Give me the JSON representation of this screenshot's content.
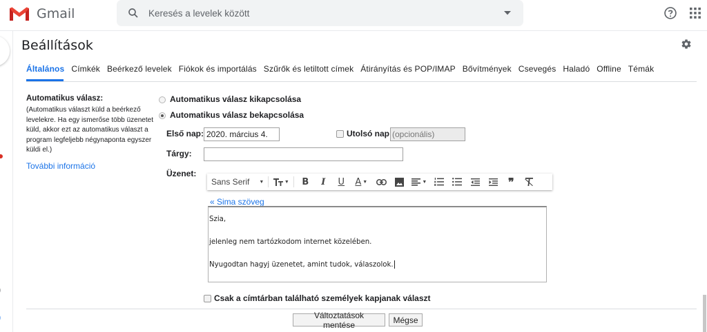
{
  "app": {
    "name": "Gmail"
  },
  "search": {
    "placeholder": "Keresés a levelek között"
  },
  "page": {
    "title": "Beállítások"
  },
  "tabs": [
    {
      "label": "Általános",
      "active": true
    },
    {
      "label": "Címkék"
    },
    {
      "label": "Beérkező levelek"
    },
    {
      "label": "Fiókok és importálás"
    },
    {
      "label": "Szűrők és letiltott címek"
    },
    {
      "label": "Átirányítás és POP/IMAP"
    },
    {
      "label": "Bővítmények"
    },
    {
      "label": "Csevegés"
    },
    {
      "label": "Haladó"
    },
    {
      "label": "Offline"
    },
    {
      "label": "Témák"
    }
  ],
  "setting": {
    "label": "Automatikus válasz:",
    "description": "(Automatikus választ küld a beérkező levelekre. Ha egy ismerőse több üzenetet küld, akkor ezt az automatikus választ a program legfeljebb négynaponta egyszer küldi el.)",
    "more_link": "További információ"
  },
  "options": {
    "off_label": "Automatikus válasz kikapcsolása",
    "on_label": "Automatikus válasz bekapcsolása",
    "selected": "on"
  },
  "form": {
    "first_day_label": "Első nap:",
    "first_day_value": "2020. március 4.",
    "last_day_label": "Utolsó nap:",
    "last_day_placeholder": "(opcionális)",
    "subject_label": "Tárgy:",
    "subject_value": "",
    "message_label": "Üzenet:"
  },
  "toolbar": {
    "font": "Sans Serif"
  },
  "editor": {
    "plain_text_link": "« Sima szöveg",
    "lines": [
      "Szia,",
      "",
      "jelenleg nem tartózkodom internet közelében.",
      "",
      "Nyugodtan hagyj üzenetet, amint tudok, válaszolok."
    ]
  },
  "contacts_only_label": "Csak a címtárban található személyek kapjanak választ",
  "buttons": {
    "save": "Változtatások mentése",
    "cancel": "Mégse"
  },
  "colors": {
    "accent": "#1a73e8",
    "gmail_red": "#d93025"
  }
}
